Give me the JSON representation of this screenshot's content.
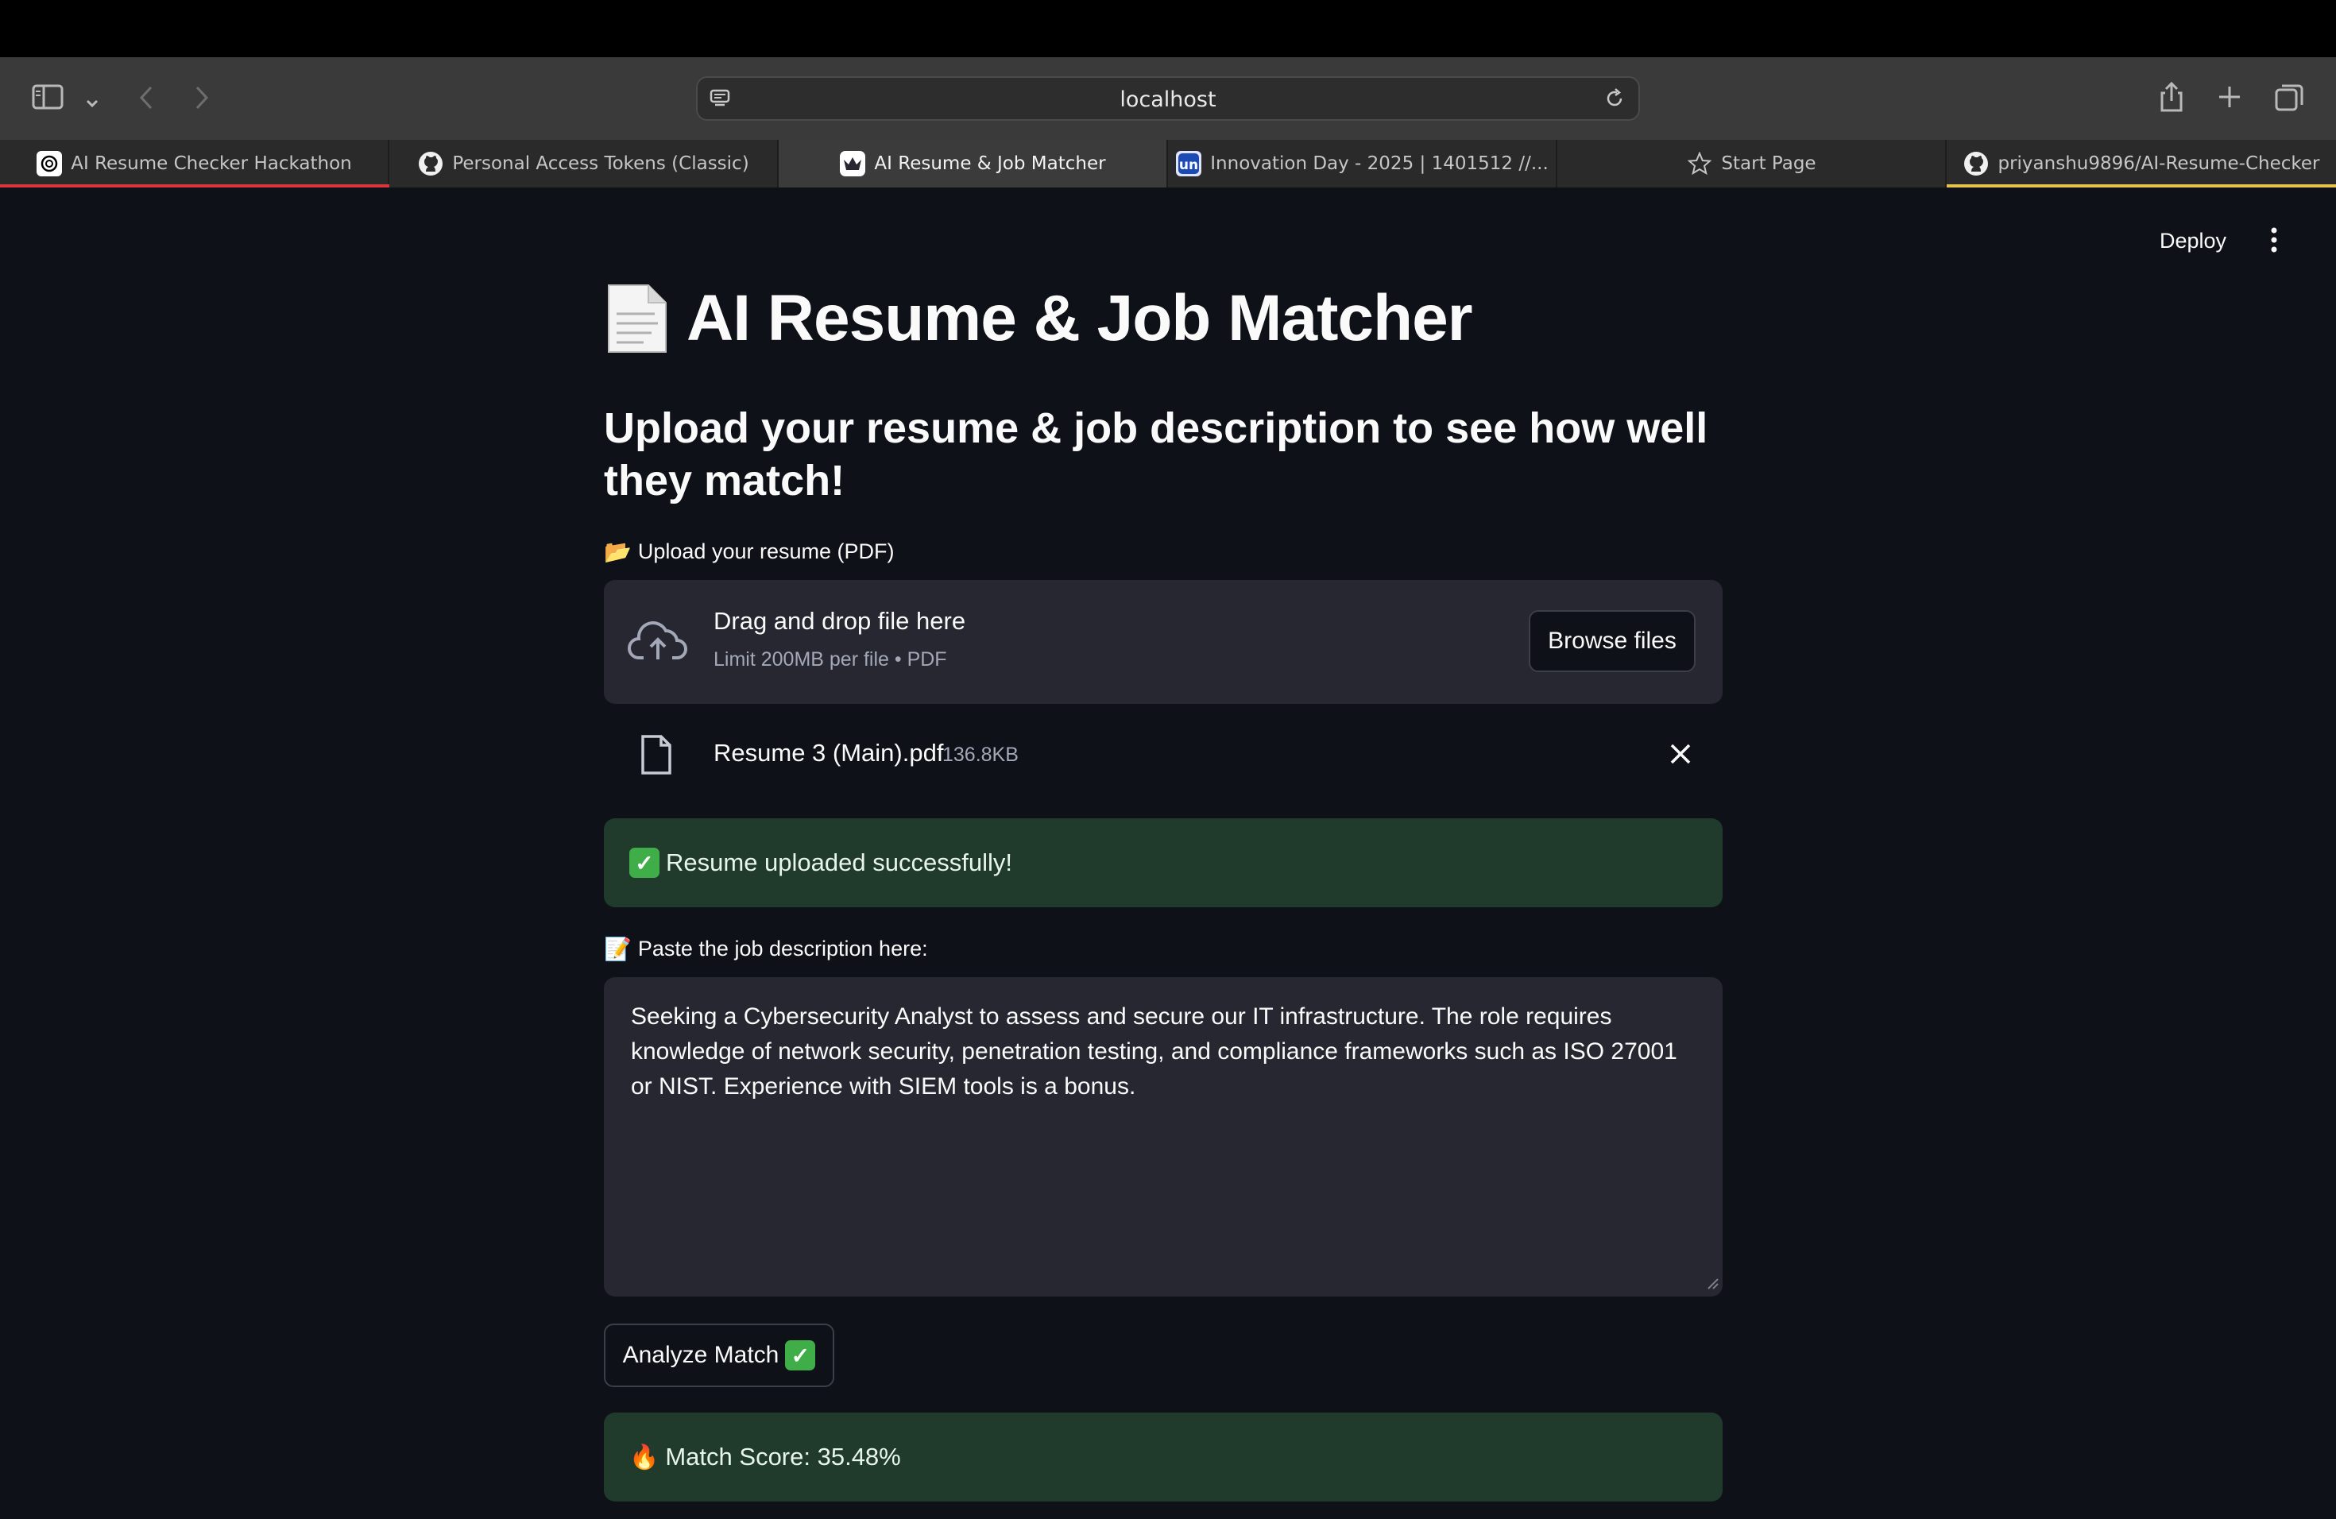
{
  "browser": {
    "url": "localhost",
    "tabs": [
      {
        "label": "AI Resume Checker Hackathon",
        "icon": "openai-icon",
        "active": false
      },
      {
        "label": "Personal Access Tokens (Classic)",
        "icon": "github-icon",
        "active": false
      },
      {
        "label": "AI Resume & Job Matcher",
        "icon": "streamlit-icon",
        "active": true
      },
      {
        "label": "Innovation Day - 2025 | 1401512 //...",
        "icon": "unstop-icon",
        "active": false
      },
      {
        "label": "Start Page",
        "icon": "star-icon",
        "active": false
      },
      {
        "label": "priyanshu9896/AI-Resume-Checker",
        "icon": "github-icon",
        "active": false
      }
    ]
  },
  "app": {
    "deploy_label": "Deploy",
    "title_emoji": "📄",
    "title": "AI Resume & Job Matcher",
    "subtitle": "Upload your resume & job description to see how well they match!",
    "resume_label_emoji": "📂",
    "resume_label": "Upload your resume (PDF)",
    "uploader": {
      "drag_text": "Drag and drop file here",
      "limit_text": "Limit 200MB per file • PDF",
      "browse_label": "Browse files"
    },
    "file": {
      "name": "Resume 3 (Main).pdf",
      "size": "136.8KB"
    },
    "upload_success": "Resume uploaded successfully!",
    "jd_label_emoji": "📝",
    "jd_label": "Paste the job description here:",
    "jd_text": "Seeking a Cybersecurity Analyst to assess and secure our IT infrastructure. The role requires knowledge of network security, penetration testing, and compliance frameworks such as ISO 27001 or NIST. Experience with SIEM tools is a bonus.",
    "analyze_label": "Analyze Match",
    "match_score_emoji": "🔥",
    "match_score": "Match Score: 35.48%"
  },
  "colors": {
    "background": "#0e1117",
    "widget_bg": "#262730",
    "success_bg": "#203a2b"
  }
}
